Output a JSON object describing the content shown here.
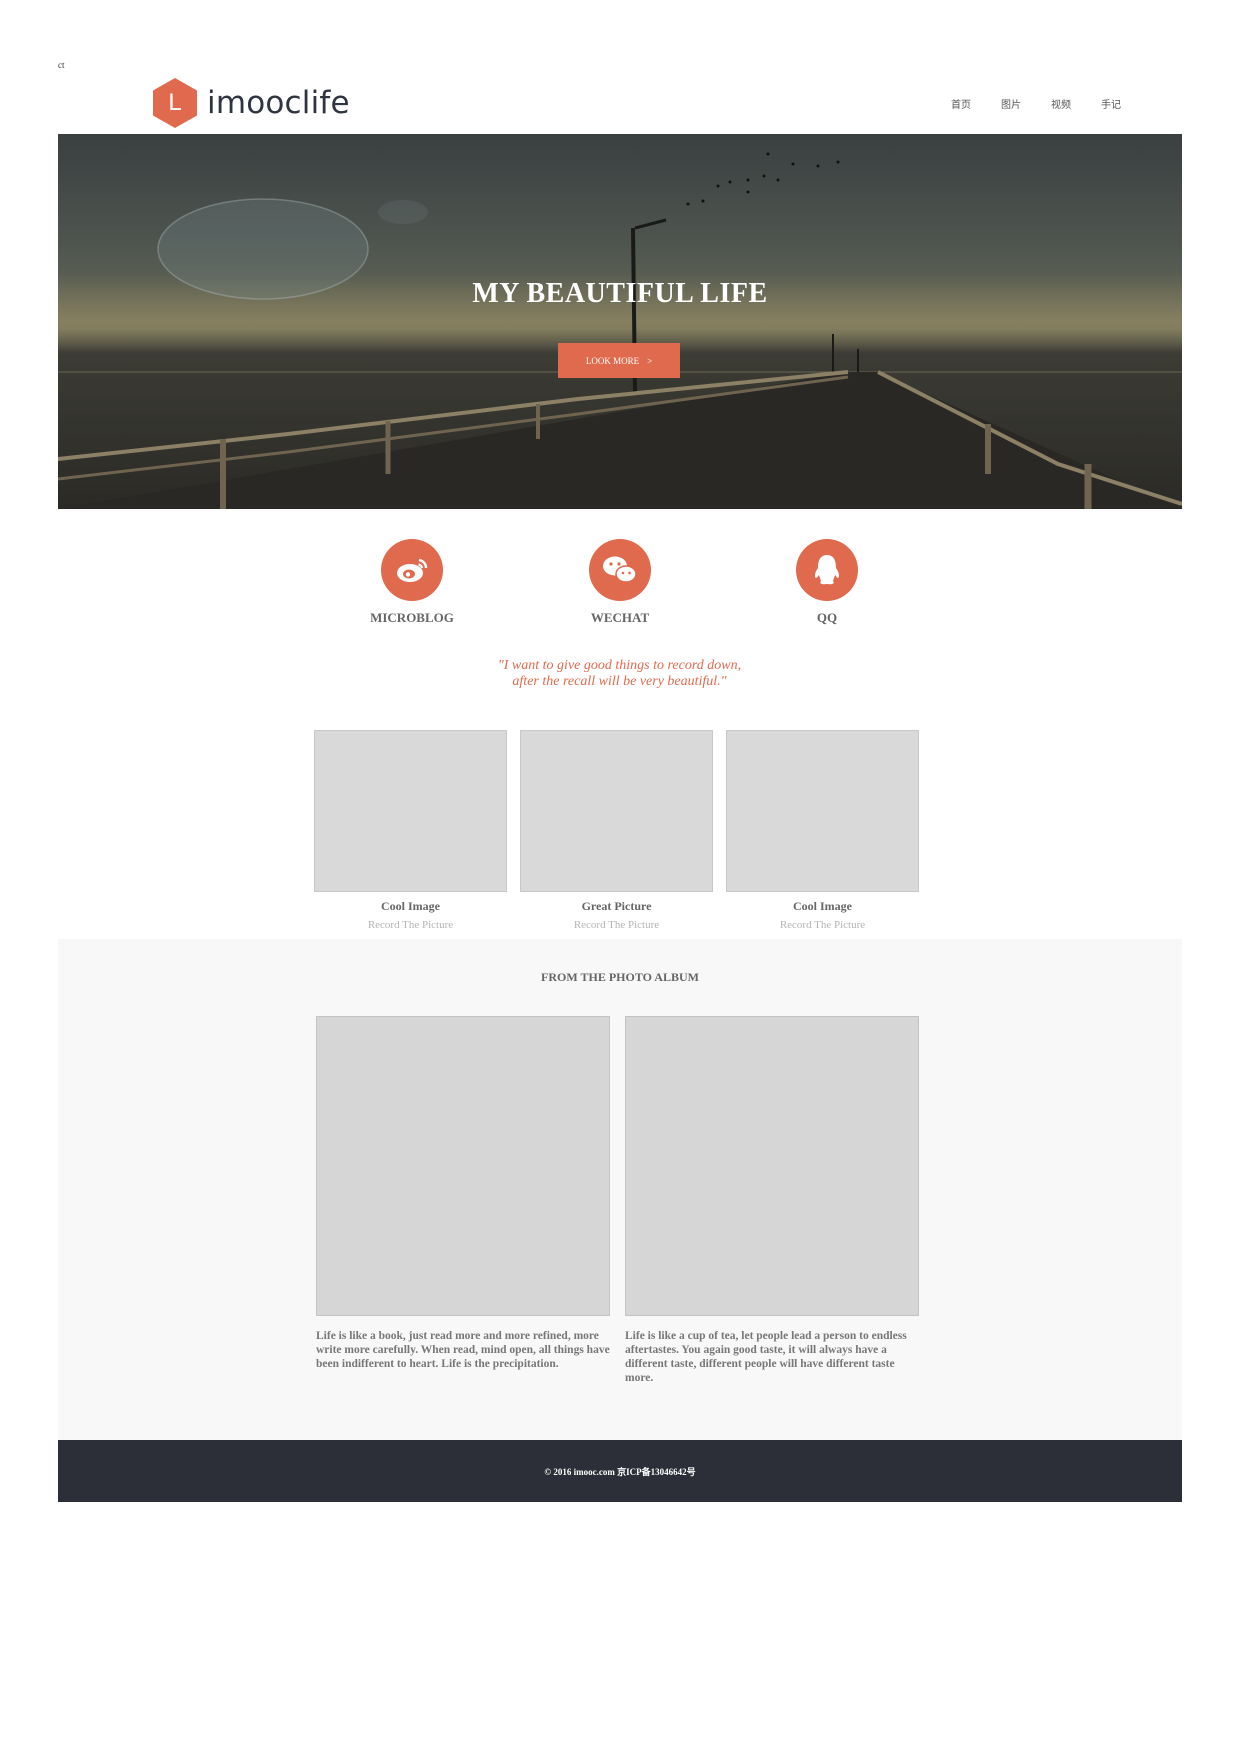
{
  "corner_text": "ct",
  "brand": {
    "logo_letter": "L",
    "name": "imooclife",
    "accent": "#e06a4e"
  },
  "nav": {
    "items": [
      "首页",
      "图片",
      "视频",
      "手记"
    ]
  },
  "banner": {
    "title": "MY BEAUTIFUL LIFE",
    "button_label": "LOOK MORE",
    "button_arrow": ">"
  },
  "social": {
    "items": [
      {
        "label": "MICROBLOG",
        "icon": "weibo-icon"
      },
      {
        "label": "WECHAT",
        "icon": "wechat-icon"
      },
      {
        "label": "QQ",
        "icon": "qq-icon"
      }
    ]
  },
  "quote": {
    "line1": "\"I want to give good things to record down,",
    "line2": "after the recall will be very beautiful.\""
  },
  "photos": [
    {
      "title": "Cool Image",
      "subtitle": "Record The Picture"
    },
    {
      "title": "Great Picture",
      "subtitle": "Record The Picture"
    },
    {
      "title": "Cool Image",
      "subtitle": "Record The Picture"
    }
  ],
  "album": {
    "heading": "FROM THE PHOTO ALBUM",
    "items": [
      {
        "text": "Life is like a book, just read more and more refined, more write more carefully. When read, mind open, all things have been indifferent to heart. Life is the precipitation."
      },
      {
        "text": "Life is like a cup of tea, let people lead a person to endless aftertastes. You again good taste, it will always have a different taste, different people will have different taste more."
      }
    ]
  },
  "footer": {
    "text": "© 2016 imooc.com 京ICP备13046642号",
    "background": "#2c2f37"
  }
}
